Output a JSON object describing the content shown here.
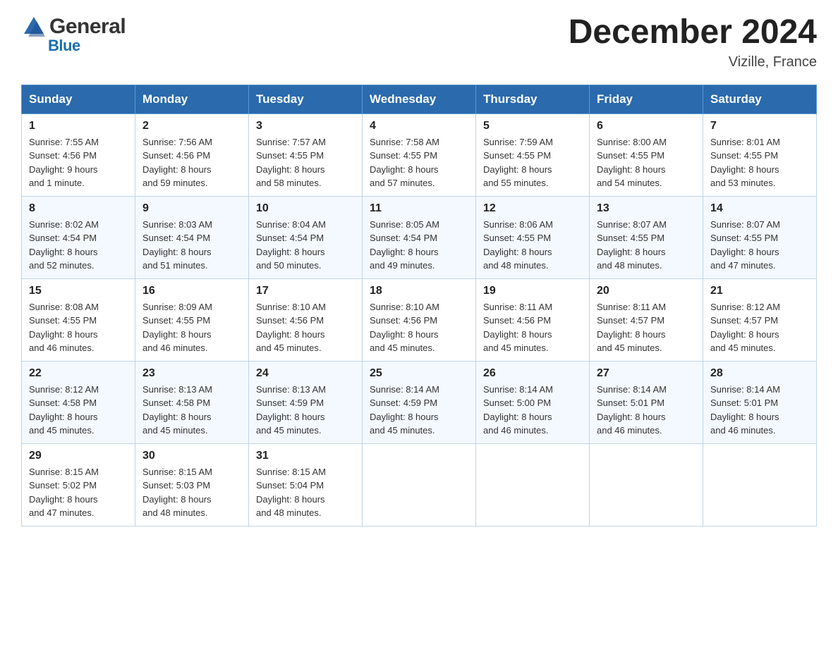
{
  "header": {
    "logo_general": "General",
    "logo_blue": "Blue",
    "month_title": "December 2024",
    "location": "Vizille, France"
  },
  "days_of_week": [
    "Sunday",
    "Monday",
    "Tuesday",
    "Wednesday",
    "Thursday",
    "Friday",
    "Saturday"
  ],
  "weeks": [
    [
      {
        "day": "1",
        "sunrise": "7:55 AM",
        "sunset": "4:56 PM",
        "daylight": "9 hours and 1 minute."
      },
      {
        "day": "2",
        "sunrise": "7:56 AM",
        "sunset": "4:56 PM",
        "daylight": "8 hours and 59 minutes."
      },
      {
        "day": "3",
        "sunrise": "7:57 AM",
        "sunset": "4:55 PM",
        "daylight": "8 hours and 58 minutes."
      },
      {
        "day": "4",
        "sunrise": "7:58 AM",
        "sunset": "4:55 PM",
        "daylight": "8 hours and 57 minutes."
      },
      {
        "day": "5",
        "sunrise": "7:59 AM",
        "sunset": "4:55 PM",
        "daylight": "8 hours and 55 minutes."
      },
      {
        "day": "6",
        "sunrise": "8:00 AM",
        "sunset": "4:55 PM",
        "daylight": "8 hours and 54 minutes."
      },
      {
        "day": "7",
        "sunrise": "8:01 AM",
        "sunset": "4:55 PM",
        "daylight": "8 hours and 53 minutes."
      }
    ],
    [
      {
        "day": "8",
        "sunrise": "8:02 AM",
        "sunset": "4:54 PM",
        "daylight": "8 hours and 52 minutes."
      },
      {
        "day": "9",
        "sunrise": "8:03 AM",
        "sunset": "4:54 PM",
        "daylight": "8 hours and 51 minutes."
      },
      {
        "day": "10",
        "sunrise": "8:04 AM",
        "sunset": "4:54 PM",
        "daylight": "8 hours and 50 minutes."
      },
      {
        "day": "11",
        "sunrise": "8:05 AM",
        "sunset": "4:54 PM",
        "daylight": "8 hours and 49 minutes."
      },
      {
        "day": "12",
        "sunrise": "8:06 AM",
        "sunset": "4:55 PM",
        "daylight": "8 hours and 48 minutes."
      },
      {
        "day": "13",
        "sunrise": "8:07 AM",
        "sunset": "4:55 PM",
        "daylight": "8 hours and 48 minutes."
      },
      {
        "day": "14",
        "sunrise": "8:07 AM",
        "sunset": "4:55 PM",
        "daylight": "8 hours and 47 minutes."
      }
    ],
    [
      {
        "day": "15",
        "sunrise": "8:08 AM",
        "sunset": "4:55 PM",
        "daylight": "8 hours and 46 minutes."
      },
      {
        "day": "16",
        "sunrise": "8:09 AM",
        "sunset": "4:55 PM",
        "daylight": "8 hours and 46 minutes."
      },
      {
        "day": "17",
        "sunrise": "8:10 AM",
        "sunset": "4:56 PM",
        "daylight": "8 hours and 45 minutes."
      },
      {
        "day": "18",
        "sunrise": "8:10 AM",
        "sunset": "4:56 PM",
        "daylight": "8 hours and 45 minutes."
      },
      {
        "day": "19",
        "sunrise": "8:11 AM",
        "sunset": "4:56 PM",
        "daylight": "8 hours and 45 minutes."
      },
      {
        "day": "20",
        "sunrise": "8:11 AM",
        "sunset": "4:57 PM",
        "daylight": "8 hours and 45 minutes."
      },
      {
        "day": "21",
        "sunrise": "8:12 AM",
        "sunset": "4:57 PM",
        "daylight": "8 hours and 45 minutes."
      }
    ],
    [
      {
        "day": "22",
        "sunrise": "8:12 AM",
        "sunset": "4:58 PM",
        "daylight": "8 hours and 45 minutes."
      },
      {
        "day": "23",
        "sunrise": "8:13 AM",
        "sunset": "4:58 PM",
        "daylight": "8 hours and 45 minutes."
      },
      {
        "day": "24",
        "sunrise": "8:13 AM",
        "sunset": "4:59 PM",
        "daylight": "8 hours and 45 minutes."
      },
      {
        "day": "25",
        "sunrise": "8:14 AM",
        "sunset": "4:59 PM",
        "daylight": "8 hours and 45 minutes."
      },
      {
        "day": "26",
        "sunrise": "8:14 AM",
        "sunset": "5:00 PM",
        "daylight": "8 hours and 46 minutes."
      },
      {
        "day": "27",
        "sunrise": "8:14 AM",
        "sunset": "5:01 PM",
        "daylight": "8 hours and 46 minutes."
      },
      {
        "day": "28",
        "sunrise": "8:14 AM",
        "sunset": "5:01 PM",
        "daylight": "8 hours and 46 minutes."
      }
    ],
    [
      {
        "day": "29",
        "sunrise": "8:15 AM",
        "sunset": "5:02 PM",
        "daylight": "8 hours and 47 minutes."
      },
      {
        "day": "30",
        "sunrise": "8:15 AM",
        "sunset": "5:03 PM",
        "daylight": "8 hours and 48 minutes."
      },
      {
        "day": "31",
        "sunrise": "8:15 AM",
        "sunset": "5:04 PM",
        "daylight": "8 hours and 48 minutes."
      },
      null,
      null,
      null,
      null
    ]
  ],
  "labels": {
    "sunrise": "Sunrise:",
    "sunset": "Sunset:",
    "daylight": "Daylight:"
  }
}
